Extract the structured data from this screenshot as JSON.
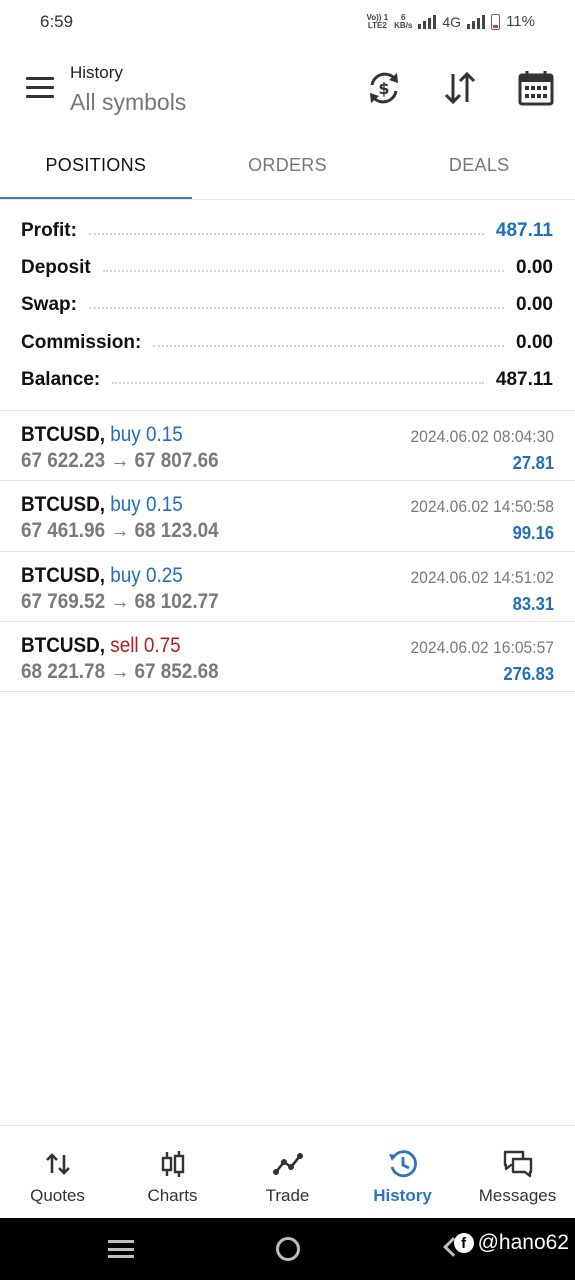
{
  "status_bar": {
    "time": "6:59",
    "volte": "Vo)) 1",
    "lte": "LTE2",
    "speed_value": "6",
    "speed_unit": "KB/s",
    "network": "4G",
    "battery": "11%"
  },
  "app_bar": {
    "title": "History",
    "subtitle": "All symbols"
  },
  "tabs": [
    {
      "label": "POSITIONS",
      "active": true
    },
    {
      "label": "ORDERS",
      "active": false
    },
    {
      "label": "DEALS",
      "active": false
    }
  ],
  "summary": [
    {
      "label": "Profit:",
      "value": "487.11"
    },
    {
      "label": "Deposit",
      "value": "0.00"
    },
    {
      "label": "Swap:",
      "value": "0.00"
    },
    {
      "label": "Commission:",
      "value": "0.00"
    },
    {
      "label": "Balance:",
      "value": "487.11"
    }
  ],
  "positions": [
    {
      "symbol": "BTCUSD,",
      "side": "buy 0.15",
      "type": "buy",
      "open": "67 622.23",
      "arrow": "→",
      "close": "67 807.66",
      "time": "2024.06.02 08:04:30",
      "profit": "27.81"
    },
    {
      "symbol": "BTCUSD,",
      "side": "buy 0.15",
      "type": "buy",
      "open": "67 461.96",
      "arrow": "→",
      "close": "68 123.04",
      "time": "2024.06.02 14:50:58",
      "profit": "99.16"
    },
    {
      "symbol": "BTCUSD,",
      "side": "buy 0.25",
      "type": "buy",
      "open": "67 769.52",
      "arrow": "→",
      "close": "68 102.77",
      "time": "2024.06.02 14:51:02",
      "profit": "83.31"
    },
    {
      "symbol": "BTCUSD,",
      "side": "sell 0.75",
      "type": "sell",
      "open": "68 221.78",
      "arrow": "→",
      "close": "67 852.68",
      "time": "2024.06.02 16:05:57",
      "profit": "276.83"
    }
  ],
  "bottom_nav": [
    {
      "label": "Quotes",
      "icon": "quotes-arrows-icon"
    },
    {
      "label": "Charts",
      "icon": "candlestick-icon"
    },
    {
      "label": "Trade",
      "icon": "trade-line-icon"
    },
    {
      "label": "History",
      "icon": "history-clock-icon",
      "active": true
    },
    {
      "label": "Messages",
      "icon": "messages-icon"
    }
  ],
  "watermark": {
    "badge": "f",
    "handle": "@hano62"
  },
  "colors": {
    "accent": "#2f74c0",
    "profit_blue": "#1f6fba",
    "sell_red": "#b71c1c",
    "muted_text": "#7a7a7a"
  }
}
